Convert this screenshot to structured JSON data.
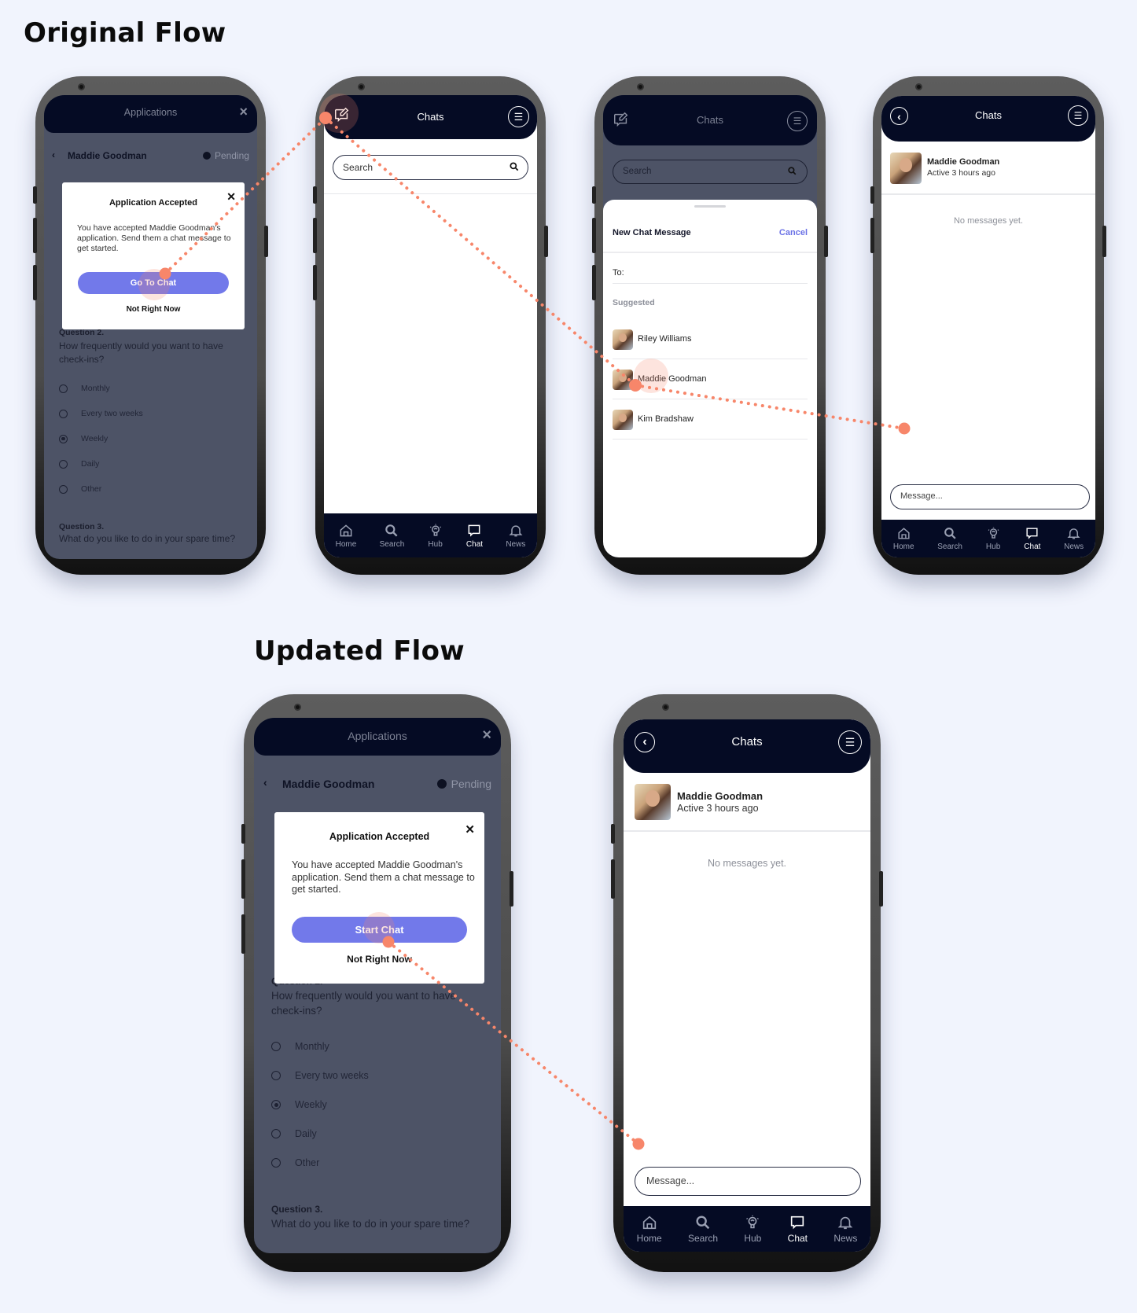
{
  "titles": {
    "original": "Original Flow",
    "updated": "Updated Flow"
  },
  "colors": {
    "background": "#f1f4fd",
    "navy": "#050b24",
    "accent": "#7279ea",
    "annotation": "#f7866a",
    "cancel": "#6b72e6"
  },
  "application_screen": {
    "header_title": "Applications",
    "close_icon": "×",
    "applicant_name": "Maddie Goodman",
    "status": "Pending",
    "modal": {
      "title": "Application Accepted",
      "body": "You have accepted Maddie Goodman's application. Send them a chat message to get started.",
      "secondary": "Not Right Now"
    },
    "question2_label": "Question 2.",
    "question2_text": "How frequently would you want to have check-ins?",
    "options": [
      {
        "label": "Monthly",
        "selected": false
      },
      {
        "label": "Every two weeks",
        "selected": false
      },
      {
        "label": "Weekly",
        "selected": true
      },
      {
        "label": "Daily",
        "selected": false
      },
      {
        "label": "Other",
        "selected": false
      }
    ],
    "question3_label": "Question 3.",
    "question3_text": "What do you like to do in your spare time?"
  },
  "original_primary_button": "Go To Chat",
  "updated_primary_button": "Start Chat",
  "chats_screen": {
    "title": "Chats",
    "search_placeholder": "Search"
  },
  "new_chat_sheet": {
    "title": "New Chat Message",
    "cancel": "Cancel",
    "to_label": "To:",
    "suggested_label": "Suggested",
    "contacts": [
      {
        "name": "Riley Williams"
      },
      {
        "name": "Maddie Goodman"
      },
      {
        "name": "Kim Bradshaw"
      }
    ]
  },
  "conversation": {
    "title": "Chats",
    "contact_name": "Maddie Goodman",
    "contact_status": "Active 3 hours ago",
    "empty_text": "No messages yet.",
    "message_placeholder": "Message..."
  },
  "tabbar": [
    {
      "label": "Home",
      "icon": "home-icon",
      "active": false
    },
    {
      "label": "Search",
      "icon": "search-icon",
      "active": false
    },
    {
      "label": "Hub",
      "icon": "lightbulb-icon",
      "active": false
    },
    {
      "label": "Chat",
      "icon": "chat-icon",
      "active": true
    },
    {
      "label": "News",
      "icon": "bell-icon",
      "active": false
    }
  ]
}
